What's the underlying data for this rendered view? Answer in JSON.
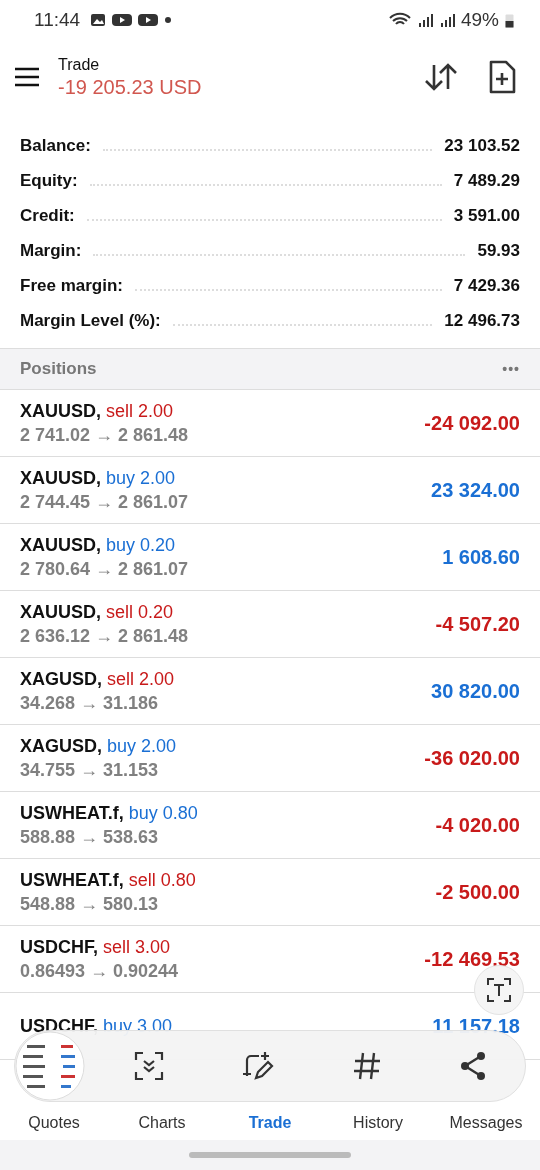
{
  "status_bar": {
    "time": "11:44",
    "battery": "49%"
  },
  "header": {
    "title": "Trade",
    "balance": "-19 205.23 USD"
  },
  "summary": [
    {
      "label": "Balance:",
      "value": "23 103.52"
    },
    {
      "label": "Equity:",
      "value": "7 489.29"
    },
    {
      "label": "Credit:",
      "value": "3 591.00"
    },
    {
      "label": "Margin:",
      "value": "59.93"
    },
    {
      "label": "Free margin:",
      "value": "7 429.36"
    },
    {
      "label": "Margin Level (%):",
      "value": "12 496.73"
    }
  ],
  "positions": {
    "title": "Positions",
    "menu": "•••",
    "rows": [
      {
        "symbol": "XAUUSD,",
        "type": "sell 2.00",
        "color": "#c81a1a",
        "prices": "2 741.02 → 2 861.48",
        "profit": "-24 092.00"
      },
      {
        "symbol": "XAUUSD,",
        "type": "buy 2.00",
        "color": "#1a6fd4",
        "prices": "2 744.45 → 2 861.07",
        "profit": "23 324.00"
      },
      {
        "symbol": "XAUUSD,",
        "type": "buy 0.20",
        "color": "#1a6fd4",
        "prices": "2 780.64 → 2 861.07",
        "profit": "1 608.60"
      },
      {
        "symbol": "XAUUSD,",
        "type": "sell 0.20",
        "color": "#c81a1a",
        "prices": "2 636.12 → 2 861.48",
        "profit": "-4 507.20"
      },
      {
        "symbol": "XAGUSD,",
        "type": "sell 2.00",
        "color": "#c81a1a",
        "prices": "34.268 → 31.186",
        "profit": "30 820.00"
      },
      {
        "symbol": "XAGUSD,",
        "type": "buy 2.00",
        "color": "#1a6fd4",
        "prices": "34.755 → 31.153",
        "profit": "-36 020.00"
      },
      {
        "symbol": "USWHEAT.f,",
        "type": "buy 0.80",
        "color": "#1a6fd4",
        "prices": "588.88 → 538.63",
        "profit": "-4 020.00"
      },
      {
        "symbol": "USWHEAT.f,",
        "type": "sell 0.80",
        "color": "#c81a1a",
        "prices": "548.88 → 580.13",
        "profit": "-2 500.00"
      },
      {
        "symbol": "USDCHF,",
        "type": "sell 3.00",
        "color": "#c81a1a",
        "prices": "0.86493 → 0.90244",
        "profit": "-12 469.53"
      },
      {
        "symbol": "USDCHF,",
        "type": "buy 3.00",
        "color": "#1a6fd4",
        "profit": "11 157.18"
      }
    ]
  },
  "nav": [
    {
      "label": "Quotes",
      "selected": false
    },
    {
      "label": "Charts",
      "selected": false
    },
    {
      "label": "Trade",
      "selected": true
    },
    {
      "label": "History",
      "selected": false
    },
    {
      "label": "Messages",
      "selected": false
    }
  ]
}
